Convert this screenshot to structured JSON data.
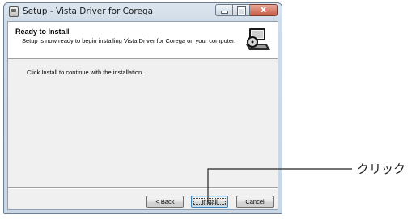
{
  "window": {
    "title": "Setup - Vista Driver for Corega",
    "close_glyph": "x"
  },
  "header": {
    "title": "Ready to Install",
    "subtitle": "Setup is now ready to begin installing Vista Driver for Corega on your computer."
  },
  "body": {
    "instruction": "Click Install to continue with the installation."
  },
  "buttons": {
    "back_label": "< Back",
    "install_label": "Install",
    "cancel_label": "Cancel"
  },
  "annotation": {
    "label": "クリック"
  },
  "icons": {
    "app": "setup-app-icon",
    "header": "computer-disk-icon"
  },
  "colors": {
    "annotation_line": "#222222",
    "focus_border": "#3c7fb1"
  }
}
